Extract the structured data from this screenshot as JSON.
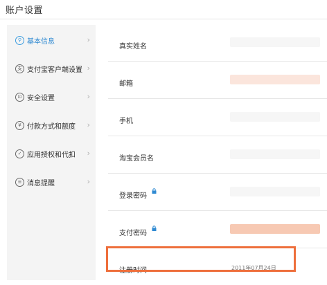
{
  "page": {
    "title": "账户设置"
  },
  "sidebar": {
    "items": [
      {
        "label": "基本信息",
        "icon": "user-icon",
        "active": true
      },
      {
        "label": "支付宝客户端设置",
        "icon": "client-icon",
        "active": false
      },
      {
        "label": "安全设置",
        "icon": "lock-icon",
        "active": false
      },
      {
        "label": "付款方式和额度",
        "icon": "yuan-icon",
        "active": false
      },
      {
        "label": "应用授权和代扣",
        "icon": "check-icon",
        "active": false
      },
      {
        "label": "消息提醒",
        "icon": "message-icon",
        "active": false
      }
    ],
    "chevron": "›"
  },
  "info": {
    "rows": [
      {
        "label": "真实姓名"
      },
      {
        "label": "邮箱"
      },
      {
        "label": "手机"
      },
      {
        "label": "淘宝会员名"
      },
      {
        "label": "登录密码",
        "lock": true
      },
      {
        "label": "支付密码",
        "lock": true
      },
      {
        "label": "注册时间",
        "value": "2011年07月24日",
        "highlighted": true
      }
    ]
  },
  "colors": {
    "accent": "#3d9de0",
    "highlight": "#ee6f3c",
    "lock": "#2f8ad2"
  }
}
